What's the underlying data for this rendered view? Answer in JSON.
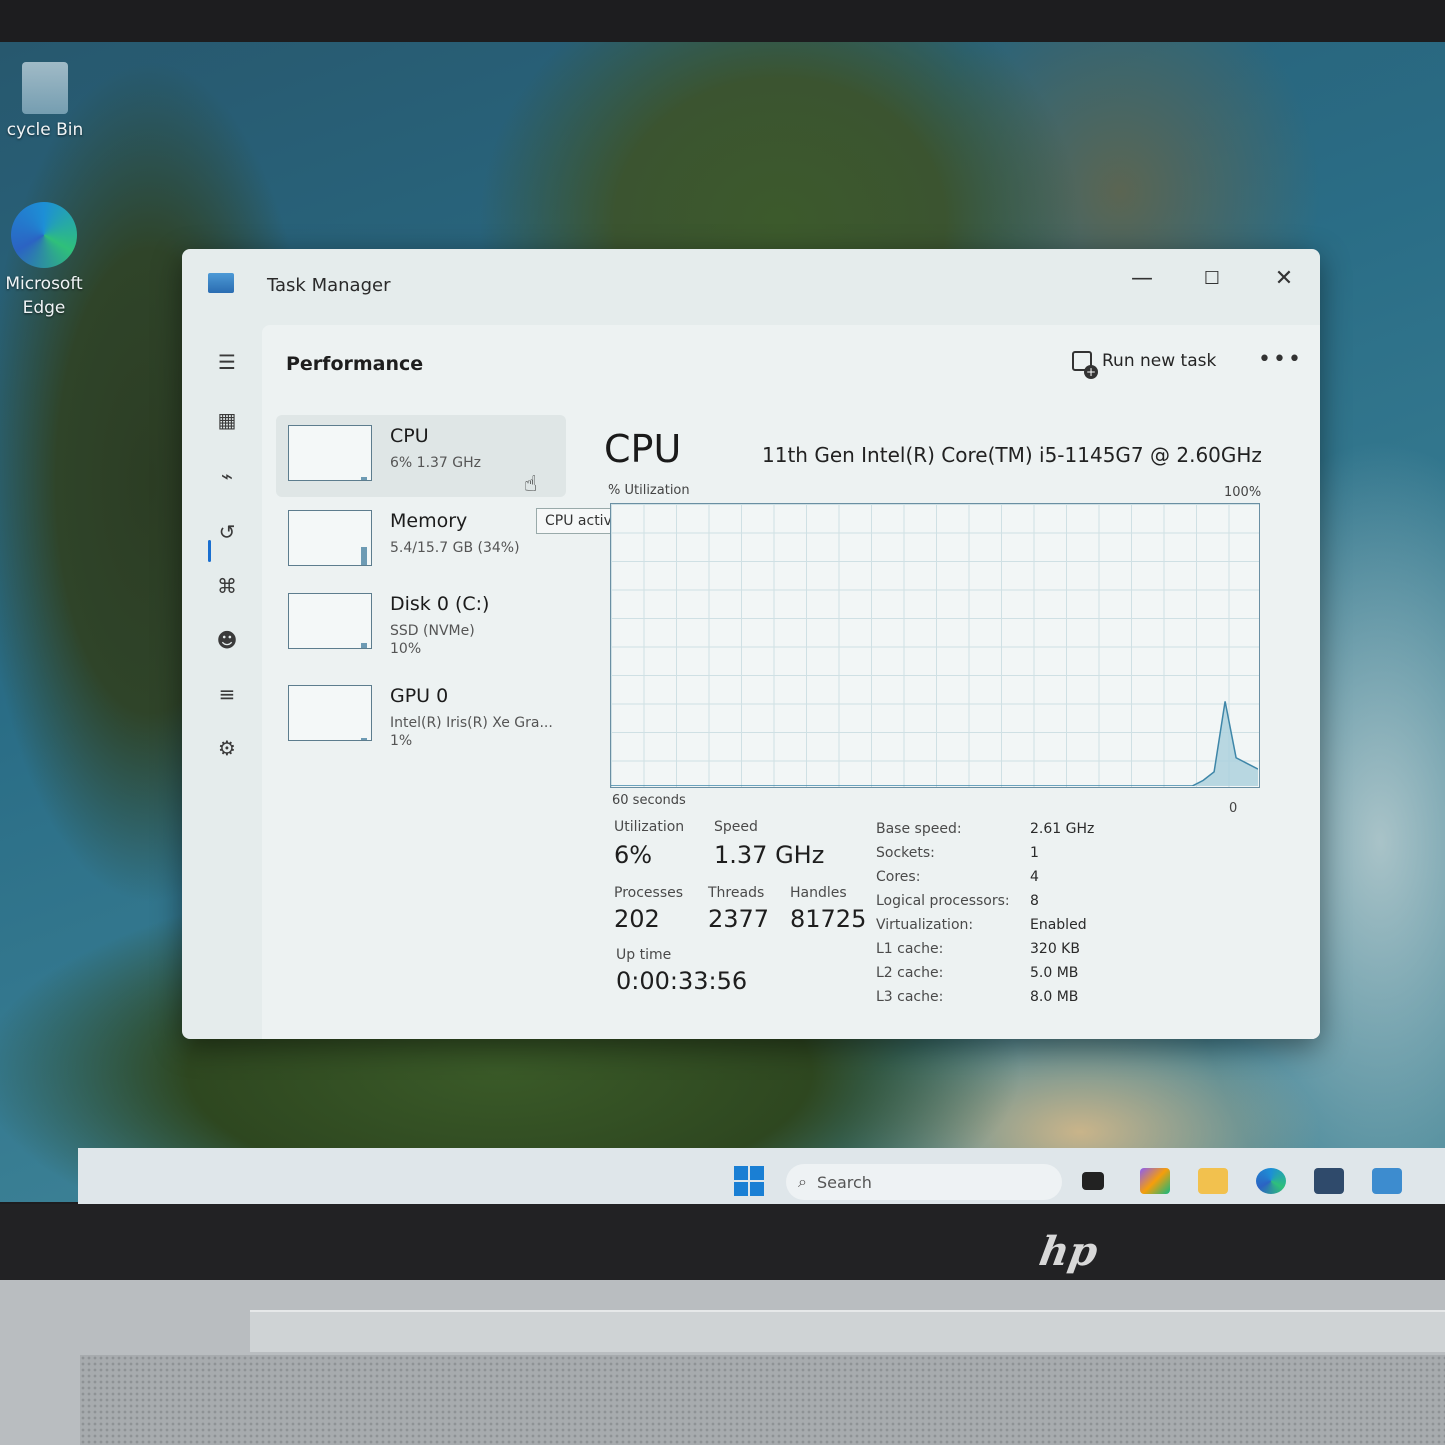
{
  "desktop": {
    "icons": [
      {
        "label": "cycle Bin"
      },
      {
        "label": "Microsoft Edge"
      }
    ]
  },
  "window": {
    "title": "Task Manager",
    "controls": {
      "minimize": "—",
      "maximize": "☐",
      "close": "✕"
    }
  },
  "nav": {
    "items": [
      {
        "icon": "hamburger-icon",
        "glyph": "☰"
      },
      {
        "icon": "processes-icon",
        "glyph": "▦"
      },
      {
        "icon": "performance-icon",
        "glyph": "⌁"
      },
      {
        "icon": "app-history-icon",
        "glyph": "↺"
      },
      {
        "icon": "startup-apps-icon",
        "glyph": "⌘"
      },
      {
        "icon": "users-icon",
        "glyph": "☻"
      },
      {
        "icon": "details-icon",
        "glyph": "≡"
      },
      {
        "icon": "services-icon",
        "glyph": "⚙"
      }
    ],
    "settings_glyph": "⚙"
  },
  "header": {
    "title": "Performance",
    "run_new_task": "Run new task",
    "more": "•••"
  },
  "devices": [
    {
      "name": "CPU",
      "sub": "6%  1.37 GHz",
      "sub2": "",
      "level": 0.06
    },
    {
      "name": "Memory",
      "sub": "5.4/15.7 GB (34%)",
      "sub2": "",
      "level": 0.34
    },
    {
      "name": "Disk 0 (C:)",
      "sub": "SSD (NVMe)",
      "sub2": "10%",
      "level": 0.1
    },
    {
      "name": "GPU 0",
      "sub": "Intel(R) Iris(R) Xe Gra...",
      "sub2": "1%",
      "level": 0.01
    }
  ],
  "tooltip": "CPU activity",
  "cpu": {
    "heading": "CPU",
    "model": "11th Gen Intel(R) Core(TM) i5-1145G7 @ 2.60GHz",
    "graph": {
      "y_label": "% Utilization",
      "y_max_label": "100%",
      "x_label": "60 seconds",
      "y_min_label": "0",
      "history": [
        0,
        0,
        0,
        0,
        0,
        0,
        0,
        0,
        0,
        0,
        0,
        0,
        0,
        0,
        0,
        0,
        0,
        0,
        0,
        0,
        0,
        0,
        0,
        0,
        0,
        0,
        0,
        0,
        0,
        0,
        0,
        0,
        0,
        0,
        0,
        0,
        0,
        0,
        0,
        0,
        0,
        0,
        0,
        0,
        0,
        0,
        0,
        0,
        0,
        0,
        0,
        0,
        0,
        0,
        2,
        5,
        30,
        10,
        8,
        6
      ]
    },
    "stats": {
      "utilization_label": "Utilization",
      "utilization": "6%",
      "speed_label": "Speed",
      "speed": "1.37 GHz",
      "processes_label": "Processes",
      "processes": "202",
      "threads_label": "Threads",
      "threads": "2377",
      "handles_label": "Handles",
      "handles": "81725",
      "uptime_label": "Up time",
      "uptime": "0:00:33:56"
    },
    "specs": [
      {
        "k": "Base speed:",
        "v": "2.61 GHz"
      },
      {
        "k": "Sockets:",
        "v": "1"
      },
      {
        "k": "Cores:",
        "v": "4"
      },
      {
        "k": "Logical processors:",
        "v": "8"
      },
      {
        "k": "Virtualization:",
        "v": "Enabled"
      },
      {
        "k": "L1 cache:",
        "v": "320 KB"
      },
      {
        "k": "L2 cache:",
        "v": "5.0 MB"
      },
      {
        "k": "L3 cache:",
        "v": "8.0 MB"
      }
    ]
  },
  "taskbar": {
    "search_placeholder": "Search"
  },
  "bezel": {
    "logo": "hp"
  }
}
